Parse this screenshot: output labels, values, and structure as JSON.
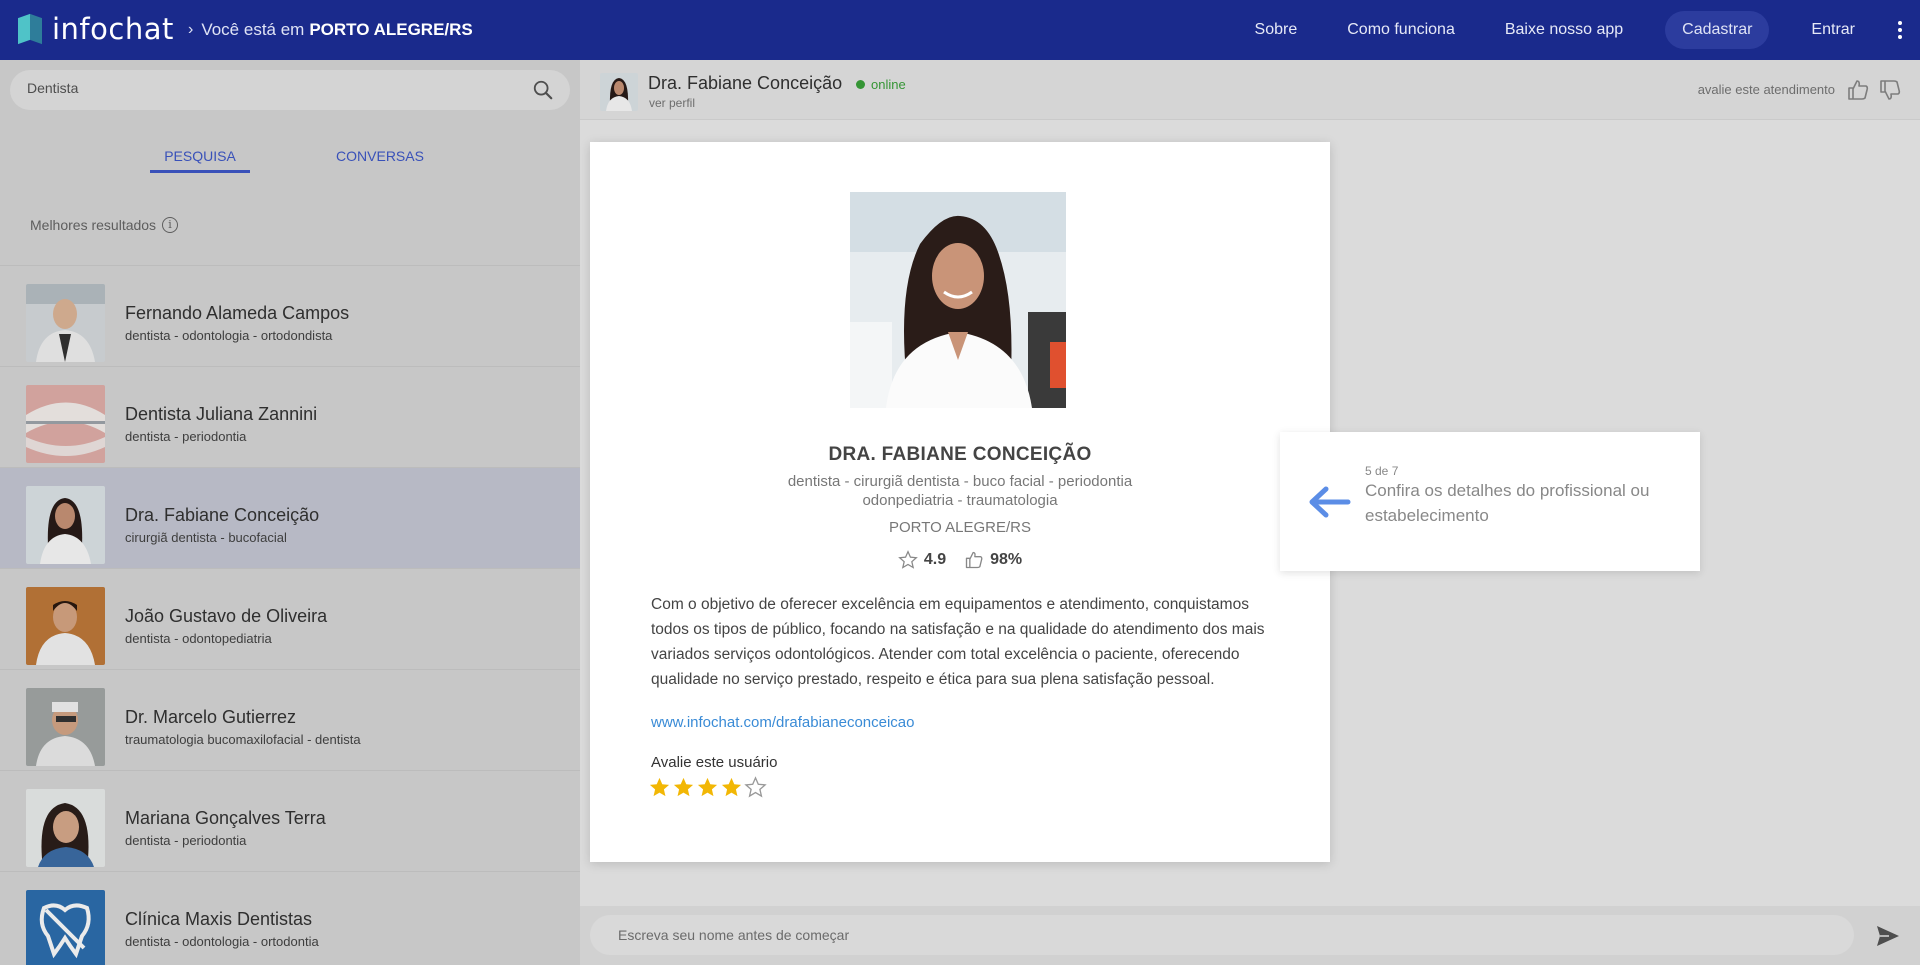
{
  "brand": {
    "name": "infochat"
  },
  "location": {
    "prefix": "Você está em",
    "city": "PORTO ALEGRE/RS"
  },
  "nav": {
    "sobre": "Sobre",
    "como_funciona": "Como funciona",
    "app": "Baixe nosso app",
    "cadastrar": "Cadastrar",
    "entrar": "Entrar"
  },
  "search": {
    "value": "Dentista"
  },
  "tabs": {
    "pesquisa": "PESQUISA",
    "conversas": "CONVERSAS"
  },
  "results_label": "Melhores resultados",
  "results": [
    {
      "name": "Fernando Alameda Campos",
      "tags": "dentista - odontologia - ortodondista"
    },
    {
      "name": "Dentista Juliana Zannini",
      "tags": "dentista - periodontia"
    },
    {
      "name": "Dra. Fabiane Conceição",
      "tags": "cirurgiã dentista - bucofacial"
    },
    {
      "name": "João Gustavo de Oliveira",
      "tags": "dentista - odontopediatria"
    },
    {
      "name": "Dr. Marcelo Gutierrez",
      "tags": "traumatologia bucomaxilofacial - dentista"
    },
    {
      "name": "Mariana Gonçalves Terra",
      "tags": "dentista - periodontia"
    },
    {
      "name": "Clínica Maxis Dentistas",
      "tags": "dentista - odontologia - ortodontia"
    }
  ],
  "chat": {
    "name": "Dra. Fabiane Conceição",
    "status": "online",
    "ver_perfil": "ver perfil",
    "avalie": "avalie este atendimento",
    "composer_placeholder": "Escreva seu nome antes de começar"
  },
  "profile": {
    "name": "DRA. FABIANE CONCEIÇÃO",
    "tags_line1": "dentista - cirurgiã dentista - buco facial - periodontia",
    "tags_line2": "odonpediatria - traumatologia",
    "city": "PORTO ALEGRE/RS",
    "rating": "4.9",
    "approval": "98%",
    "description": "Com o objetivo de oferecer excelência em equipamentos e atendimento, conquistamos todos os tipos de público, focando na satisfação e na qualidade do atendimento dos mais variados serviços odontológicos. Atender com total excelência o paciente, oferecendo qualidade no serviço prestado, respeito e ética para sua plena satisfação pessoal.",
    "link": "www.infochat.com/drafabianeconceicao",
    "rate_label": "Avalie este usuário",
    "user_stars": 4,
    "max_stars": 5
  },
  "tour": {
    "step": "5 de 7",
    "text": "Confira os detalhes do profissional ou estabelecimento"
  },
  "colors": {
    "header": "#1a2a8c",
    "accent": "#3e58c9",
    "star": "#f2b705",
    "online": "#3aa23a"
  }
}
